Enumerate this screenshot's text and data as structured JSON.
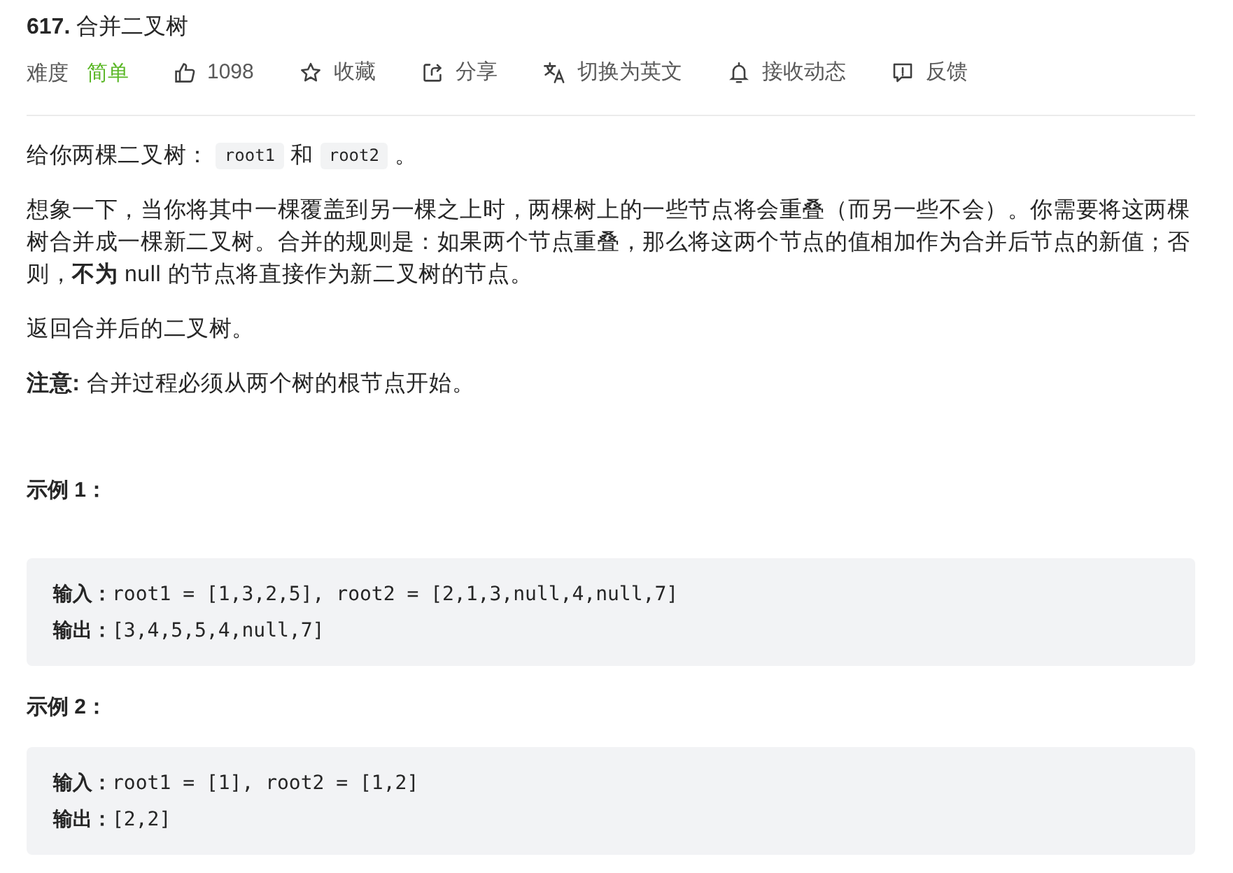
{
  "problem": {
    "title": "**617.** 合并二叉树"
  },
  "meta": {
    "difficulty_label": "难度",
    "difficulty": {
      "label": "简单",
      "kind": "easy"
    },
    "actions": [
      {
        "kind": "like",
        "label": "1098"
      },
      {
        "kind": "favorite",
        "label": "收藏"
      },
      {
        "kind": "share",
        "label": "分享"
      },
      {
        "kind": "translate",
        "label": "切换为英文"
      },
      {
        "kind": "subscribe",
        "label": "接收动态"
      },
      {
        "kind": "feedback",
        "label": "反馈"
      }
    ]
  },
  "description": [
    {
      "kind": "mixed",
      "parts": [
        {
          "kind": "text",
          "text": "给你两棵二叉树："
        },
        {
          "kind": "code",
          "text": "root1"
        },
        {
          "kind": "text",
          "text": "和"
        },
        {
          "kind": "code",
          "text": "root2"
        },
        {
          "kind": "text",
          "text": "。"
        }
      ]
    },
    {
      "kind": "text",
      "text": "想象一下，当你将其中一棵覆盖到另一棵之上时，两棵树上的一些节点将会重叠（而另一些不会）。你需要将这两棵树合并成一棵新二叉树。合并的规则是：如果两个节点重叠，那么将这两个节点的值相加作为合并后节点的新值；否则，**不为** null 的节点将直接作为新二叉树的节点。"
    },
    {
      "kind": "text",
      "text": "返回合并后的二叉树。"
    },
    {
      "kind": "text",
      "text": "**注意:** 合并过程必须从两个树的根节点开始。"
    }
  ],
  "examples": [
    {
      "title": "示例 1：",
      "lines": [
        "**输入：**root1 = [1,3,2,5], root2 = [2,1,3,null,4,null,7]",
        "**输出：**[3,4,5,5,4,null,7]"
      ]
    },
    {
      "title": "示例 2：",
      "lines": [
        "**输入：**root1 = [1], root2 = [1,2]",
        "**输出：**[2,2]"
      ]
    }
  ]
}
